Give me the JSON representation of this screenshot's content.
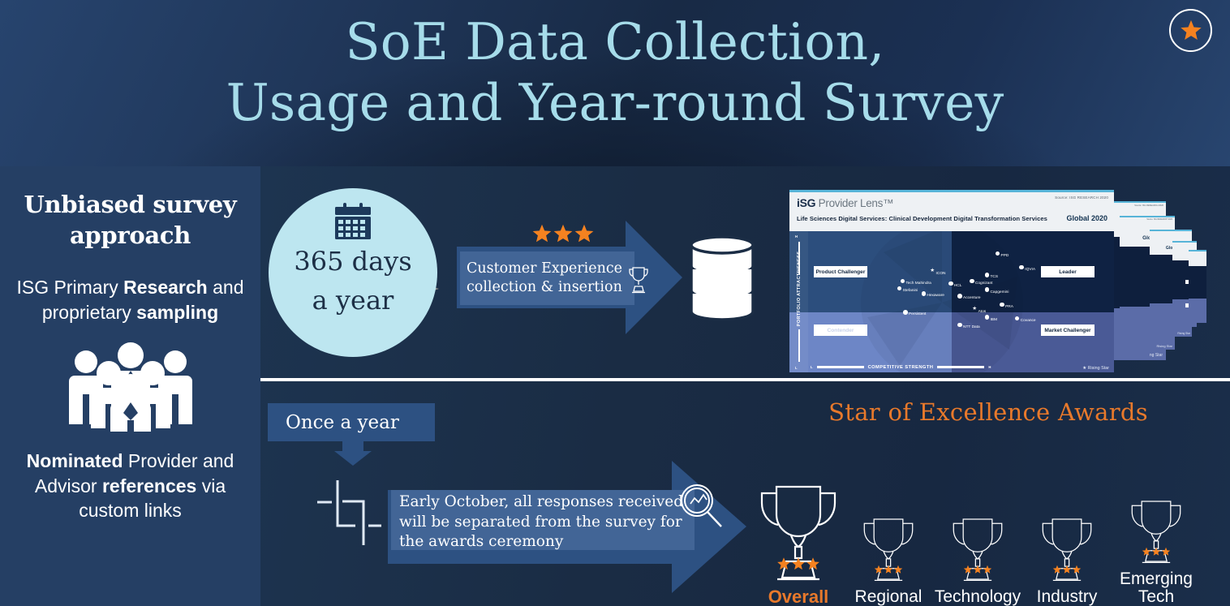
{
  "header": {
    "title_line1": "SoE Data Collection,",
    "title_line2": "Usage and Year-round Survey",
    "badge_icon": "star-icon",
    "title_color": "#a6dcea"
  },
  "sidebar": {
    "heading": "Unbiased survey approach",
    "paragraph1": {
      "before": "ISG Primary ",
      "bold1": "Research",
      "middle": " and proprietary ",
      "bold2": "sampling"
    },
    "icon": "people-group-icon",
    "paragraph2": {
      "bold1": "Nominated",
      "middle1": " Provider and Advisor ",
      "bold2": "references",
      "after": " via custom links"
    }
  },
  "top_row": {
    "circle": {
      "icon": "calendar-icon",
      "line1": "365 days",
      "line2": "a year",
      "fill_color": "#bde6f0"
    },
    "arrow_flow": {
      "stars": 3,
      "star_color": "#f58220",
      "label_line1": "Customer Experience",
      "label_line2": "collection & insertion",
      "trophy_icon": "trophy-icon",
      "arrow_color": "#2d5182"
    },
    "database_icon": "database-cylinder-icon"
  },
  "bottom_row": {
    "once_badge": "Once a year",
    "down_arrow_icon": "arrow-down-icon",
    "split_icon": "data-split-icon",
    "callout_text": "Early October, all responses received will be separated from the survey for the awards ceremony",
    "magnifier_icon": "magnifier-chart-icon",
    "awards": {
      "title": "Star of Excellence Awards",
      "title_color": "#e8792b",
      "items": [
        {
          "label": "Overall",
          "stars": 3,
          "primary": true
        },
        {
          "label": "Regional",
          "stars": 3,
          "primary": false
        },
        {
          "label": "Technology",
          "stars": 3,
          "primary": false
        },
        {
          "label": "Industry",
          "stars": 3,
          "primary": false
        },
        {
          "label": "Emerging Tech",
          "stars": 3,
          "primary": false
        }
      ]
    }
  },
  "chart_data": {
    "type": "scatter",
    "title": "iSG Provider Lens™",
    "logo_isg": "iSG",
    "logo_rest": " Provider Lens™",
    "subtitle": "Life Sciences Digital Services: Clinical Development Digital Transformation Services",
    "edition": "Global 2020",
    "source": "Source: ISG RESEARCH 2020",
    "xlabel": "COMPETITIVE STRENGTH",
    "ylabel": "PORTFOLIO ATTRACTIVENESS",
    "x_low": "L",
    "x_high": "H",
    "y_low": "L",
    "y_high": "H",
    "xlim": [
      0,
      100
    ],
    "ylim": [
      0,
      100
    ],
    "grid": false,
    "legend": "★  Rising Star",
    "legend_position": "bottom-right",
    "quadrants": [
      {
        "name": "Product Challenger",
        "position": "top-left",
        "color": "#2c4e7d"
      },
      {
        "name": "Leader",
        "position": "top-right",
        "color": "#0f2243"
      },
      {
        "name": "Contender",
        "position": "bottom-left",
        "color": "#6d86c6"
      },
      {
        "name": "Market Challenger",
        "position": "bottom-right",
        "color": "#4a5a96"
      }
    ],
    "points": [
      {
        "name": "PPD",
        "x": 62.5,
        "y": 86,
        "rising_star": false
      },
      {
        "name": "IQVIA",
        "x": 70.5,
        "y": 75,
        "rising_star": false
      },
      {
        "name": "TCS",
        "x": 59,
        "y": 69,
        "rising_star": false
      },
      {
        "name": "ICON",
        "x": 41,
        "y": 72,
        "rising_star": true
      },
      {
        "name": "Tech Mahindra",
        "x": 31,
        "y": 64,
        "rising_star": false
      },
      {
        "name": "Cognizant",
        "x": 54,
        "y": 64,
        "rising_star": false
      },
      {
        "name": "HCL",
        "x": 47,
        "y": 62,
        "rising_star": false
      },
      {
        "name": "Stefanini",
        "x": 30,
        "y": 58,
        "rising_star": false
      },
      {
        "name": "Capgemini",
        "x": 59,
        "y": 57,
        "rising_star": false
      },
      {
        "name": "Hexaware",
        "x": 38,
        "y": 54,
        "rising_star": false
      },
      {
        "name": "Accenture",
        "x": 50,
        "y": 52,
        "rising_star": false
      },
      {
        "name": "PRA",
        "x": 64,
        "y": 45,
        "rising_star": false
      },
      {
        "name": "Atos",
        "x": 55,
        "y": 41,
        "rising_star": true
      },
      {
        "name": "Persistent",
        "x": 32,
        "y": 39,
        "rising_star": false
      },
      {
        "name": "IBM",
        "x": 59,
        "y": 35,
        "rising_star": false
      },
      {
        "name": "Covance",
        "x": 69,
        "y": 34,
        "rising_star": false
      },
      {
        "name": "NTT Data",
        "x": 50,
        "y": 29,
        "rising_star": false
      }
    ],
    "stacked_copies": 5
  }
}
